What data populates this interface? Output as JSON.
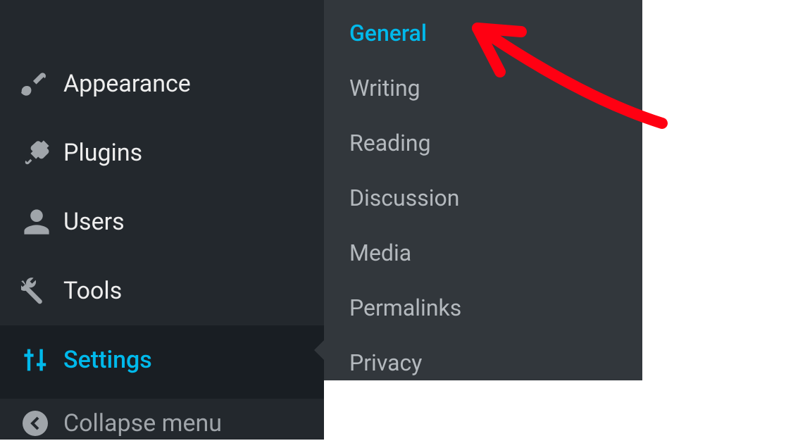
{
  "sidebar": {
    "items": [
      {
        "label": "Appearance",
        "icon": "appearance"
      },
      {
        "label": "Plugins",
        "icon": "plugins"
      },
      {
        "label": "Users",
        "icon": "users"
      },
      {
        "label": "Tools",
        "icon": "tools"
      },
      {
        "label": "Settings",
        "icon": "settings",
        "active": true
      }
    ],
    "collapse_label": "Collapse menu"
  },
  "submenu": {
    "items": [
      {
        "label": "General",
        "active": true
      },
      {
        "label": "Writing"
      },
      {
        "label": "Reading"
      },
      {
        "label": "Discussion"
      },
      {
        "label": "Media"
      },
      {
        "label": "Permalinks"
      },
      {
        "label": "Privacy"
      }
    ]
  },
  "colors": {
    "accent": "#00b9eb",
    "sidebar_bg": "#23282d",
    "submenu_bg": "#32373c",
    "annotation": "#ff0000"
  }
}
